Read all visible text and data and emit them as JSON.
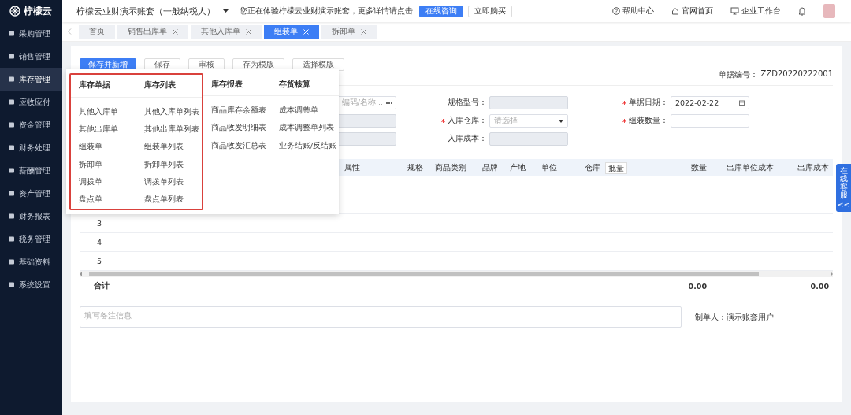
{
  "brand": {
    "name": "柠檬云"
  },
  "sidebar": {
    "items": [
      {
        "label": "采购管理",
        "selected": false
      },
      {
        "label": "销售管理",
        "selected": false
      },
      {
        "label": "库存管理",
        "selected": true
      },
      {
        "label": "应收应付",
        "selected": false
      },
      {
        "label": "资金管理",
        "selected": false
      },
      {
        "label": "财务处理",
        "selected": false
      },
      {
        "label": "薪酬管理",
        "selected": false
      },
      {
        "label": "资产管理",
        "selected": false
      },
      {
        "label": "财务报表",
        "selected": false
      },
      {
        "label": "税务管理",
        "selected": false
      },
      {
        "label": "基础资料",
        "selected": false
      },
      {
        "label": "系统设置",
        "selected": false
      }
    ]
  },
  "header": {
    "account": "柠檬云业财演示账套（一般纳税人）",
    "notice": "您正在体验柠檬云业财演示账套，更多详情请点击",
    "consult_button": "在线咨询",
    "buy_button": "立即购买",
    "links": [
      {
        "kind": "help",
        "label": "帮助中心"
      },
      {
        "kind": "home",
        "label": "官网首页"
      },
      {
        "kind": "desktop",
        "label": "企业工作台"
      }
    ]
  },
  "tabs": [
    {
      "label": "首页",
      "closable": false,
      "selected": false
    },
    {
      "label": "销售出库单",
      "closable": true,
      "selected": false
    },
    {
      "label": "其他入库单",
      "closable": true,
      "selected": false
    },
    {
      "label": "组装单",
      "closable": true,
      "selected": true
    },
    {
      "label": "拆卸单",
      "closable": true,
      "selected": false
    }
  ],
  "toolbar": {
    "buttons": [
      {
        "label": "保存并新增",
        "primary": true
      },
      {
        "label": "保存",
        "primary": false
      },
      {
        "label": "审核",
        "primary": false
      },
      {
        "label": "存为模版",
        "primary": false
      },
      {
        "label": "选择模版",
        "primary": false
      }
    ]
  },
  "doc_number": {
    "label": "单据编号：",
    "value": "ZZD20220222001"
  },
  "form": {
    "rows": [
      [
        {
          "kind": "picker",
          "placeholder": "编码/名称...",
          "disabled": false
        },
        {
          "kind": "text",
          "label": "规格型号：",
          "required": false,
          "disabled": true
        },
        {
          "kind": "date",
          "label": "单据日期：",
          "required": true,
          "disabled": false,
          "value": "2022-02-22"
        }
      ],
      [
        {
          "kind": "text",
          "disabled": true
        },
        {
          "kind": "select",
          "label": "入库仓库：",
          "required": true,
          "disabled": false,
          "placeholder": "请选择"
        },
        {
          "kind": "text",
          "label": "组装数量：",
          "required": true,
          "disabled": false
        }
      ],
      [
        {
          "kind": "text",
          "disabled": true
        },
        {
          "kind": "text",
          "label": "入库成本：",
          "required": false,
          "disabled": true
        }
      ]
    ]
  },
  "table": {
    "columns": [
      {
        "label": "属性"
      },
      {
        "label": "规格"
      },
      {
        "label": "商品类别"
      },
      {
        "label": "品牌"
      },
      {
        "label": "产地"
      },
      {
        "label": "单位"
      },
      {
        "label": "仓库",
        "button": "批量"
      },
      {
        "label": "数量"
      },
      {
        "label": "出库单位成本"
      },
      {
        "label": "出库成本"
      }
    ],
    "rows": [
      {
        "index": "3"
      },
      {
        "index": "4"
      },
      {
        "index": "5"
      }
    ],
    "total": {
      "label": "合计",
      "quantity": "0.00",
      "cost": "0.00"
    }
  },
  "remark": {
    "placeholder": "填写备注信息"
  },
  "creator": "制单人：演示账套用户",
  "menu": {
    "groups": [
      {
        "highlighted": true,
        "columns": [
          {
            "title": "库存单据",
            "items": [
              "其他入库单",
              "其他出库单",
              "组装单",
              "拆卸单",
              "调拨单",
              "盘点单"
            ]
          },
          {
            "title": "库存列表",
            "items": [
              "其他入库单列表",
              "其他出库单列表",
              "组装单列表",
              "拆卸单列表",
              "调拨单列表",
              "盘点单列表"
            ]
          }
        ]
      },
      {
        "highlighted": false,
        "columns": [
          {
            "title": "库存报表",
            "items": [
              "商品库存余额表",
              "商品收发明细表",
              "商品收发汇总表"
            ]
          },
          {
            "title": "存货核算",
            "items": [
              "成本调整单",
              "成本调整单列表",
              "业务结账/反结账"
            ]
          }
        ]
      }
    ]
  },
  "service_tab": {
    "label": "在线客服",
    "collapse": "<<"
  }
}
